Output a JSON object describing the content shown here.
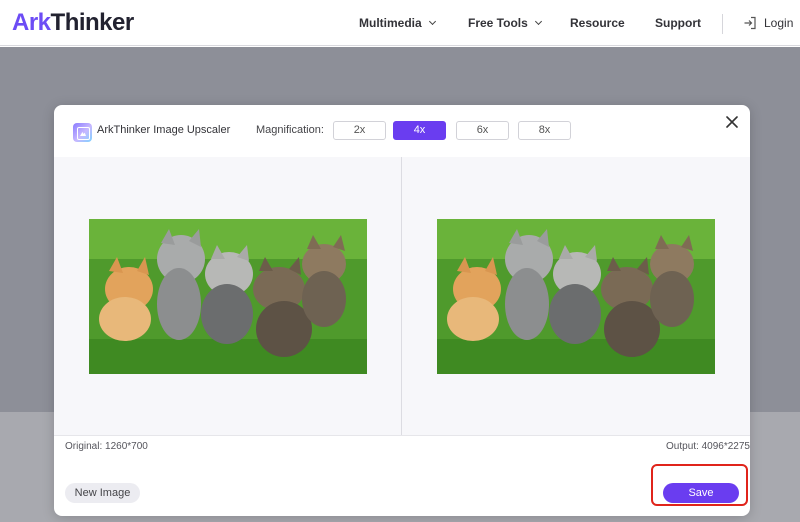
{
  "site": {
    "logo_prefix": "Ark",
    "logo_suffix": "Thinker",
    "nav": [
      {
        "label": "Multimedia",
        "icon": "chevron-down-icon"
      },
      {
        "label": "Free Tools",
        "icon": "chevron-down-icon"
      },
      {
        "label": "Resource"
      },
      {
        "label": "Support"
      }
    ],
    "login": {
      "label": "Login",
      "icon": "login-icon"
    }
  },
  "modal": {
    "app_title": "ArkThinker Image Upscaler",
    "app_icon": "image-upscaler-icon",
    "magnification_label": "Magnification:",
    "magnification_options": [
      "2x",
      "4x",
      "6x",
      "8x"
    ],
    "selected_magnification": "4x",
    "close_icon": "close-icon",
    "original_info": "Original: 1260*700",
    "output_info": "Output: 4096*2275",
    "new_image_label": "New Image",
    "save_label": "Save"
  },
  "colors": {
    "brand_purple": "#6a3df0",
    "logo_purple": "#6c4cf5",
    "highlight_red": "#e0241b",
    "overlay": "#8d8f98"
  }
}
